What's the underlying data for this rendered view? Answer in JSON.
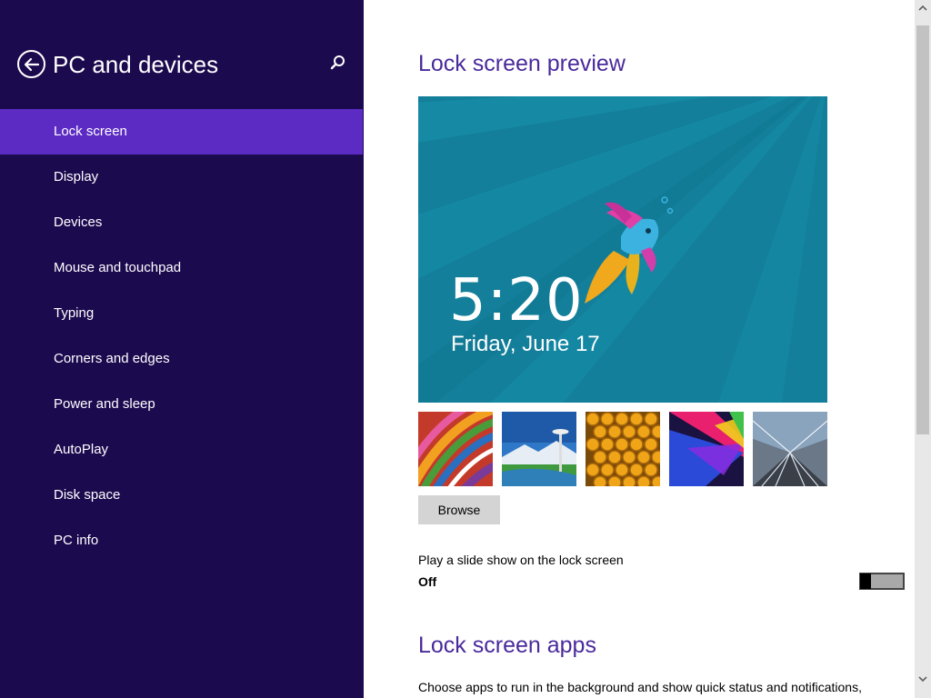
{
  "sidebar": {
    "title": "PC and devices",
    "back_icon": "back-arrow-icon",
    "search_icon": "search-icon",
    "items": [
      {
        "label": "Lock screen",
        "active": true
      },
      {
        "label": "Display"
      },
      {
        "label": "Devices"
      },
      {
        "label": "Mouse and touchpad"
      },
      {
        "label": "Typing"
      },
      {
        "label": "Corners and edges"
      },
      {
        "label": "Power and sleep"
      },
      {
        "label": "AutoPlay"
      },
      {
        "label": "Disk space"
      },
      {
        "label": "PC info"
      }
    ]
  },
  "main": {
    "preview_title": "Lock screen preview",
    "preview": {
      "time": "5:20",
      "date": "Friday, June 17"
    },
    "thumbnails": [
      "colorful-stripes-image",
      "seattle-space-needle-image",
      "honeycomb-image",
      "abstract-color-shapes-image",
      "tunnel-lights-image"
    ],
    "browse_label": "Browse",
    "slideshow": {
      "label": "Play a slide show on the lock screen",
      "state": "Off",
      "enabled": false
    },
    "apps_title": "Lock screen apps",
    "apps_description": "Choose apps to run in the background and show quick status and notifications,"
  },
  "colors": {
    "sidebar_bg": "#1c0a4f",
    "active_item_bg": "#5c2bc4",
    "heading": "#4a2a9c",
    "preview_bg": "#137f9a"
  }
}
